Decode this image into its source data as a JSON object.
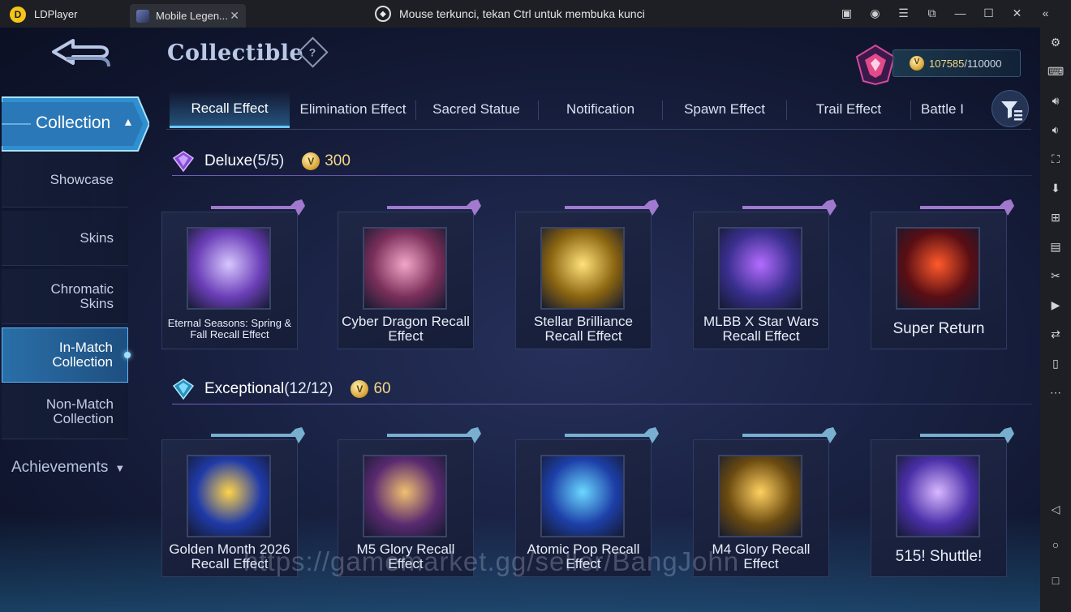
{
  "emulator": {
    "app_name": "LDPlayer",
    "tab_title": "Mobile Legen...",
    "lock_notice": "Mouse terkunci, tekan Ctrl untuk membuka kunci"
  },
  "header": {
    "title": "Collectible",
    "help_label": "?",
    "currency_value": "107585",
    "currency_max": "/110000"
  },
  "nav": {
    "collection_label": "Collection",
    "items": [
      "Showcase",
      "Skins",
      "Chromatic Skins",
      "In-Match Collection",
      "Non-Match Collection"
    ],
    "active": "In-Match Collection",
    "achievements_label": "Achievements"
  },
  "tabs": [
    "Recall Effect",
    "Elimination Effect",
    "Sacred Statue",
    "Notification",
    "Spawn Effect",
    "Trail Effect",
    "Battle I"
  ],
  "active_tab": "Recall Effect",
  "sections": [
    {
      "name": "Deluxe",
      "count": "(5/5)",
      "price": "300",
      "items": [
        {
          "name": "Eternal Seasons: Spring & Fall Recall Effect",
          "colors": [
            "#6b3fb8",
            "#d7c7ff"
          ]
        },
        {
          "name": "Cyber Dragon Recall Effect",
          "colors": [
            "#7a2f5a",
            "#f2a6c8"
          ]
        },
        {
          "name": "Stellar Brilliance Recall Effect",
          "colors": [
            "#8a6410",
            "#ffe27a"
          ]
        },
        {
          "name": "MLBB X Star Wars Recall Effect",
          "colors": [
            "#3a2f8f",
            "#b46cff"
          ]
        },
        {
          "name": "Super Return",
          "colors": [
            "#5a0e14",
            "#ff5a2a"
          ]
        }
      ]
    },
    {
      "name": "Exceptional",
      "count": "(12/12)",
      "price": "60",
      "items": [
        {
          "name": "Golden Month 2026 Recall Effect",
          "colors": [
            "#1f3aa8",
            "#ffd34a"
          ]
        },
        {
          "name": "M5 Glory Recall Effect",
          "colors": [
            "#5a2a70",
            "#f0c070"
          ]
        },
        {
          "name": "Atomic Pop Recall Effect",
          "colors": [
            "#1d3fa8",
            "#6ad8ff"
          ]
        },
        {
          "name": "M4 Glory Recall Effect",
          "colors": [
            "#6a4a10",
            "#ffd060"
          ]
        },
        {
          "name": "515! Shuttle!",
          "colors": [
            "#4a2fa8",
            "#d8b8ff"
          ]
        }
      ]
    }
  ],
  "watermark": "https://gamemarket.gg/seller/BangJohn"
}
